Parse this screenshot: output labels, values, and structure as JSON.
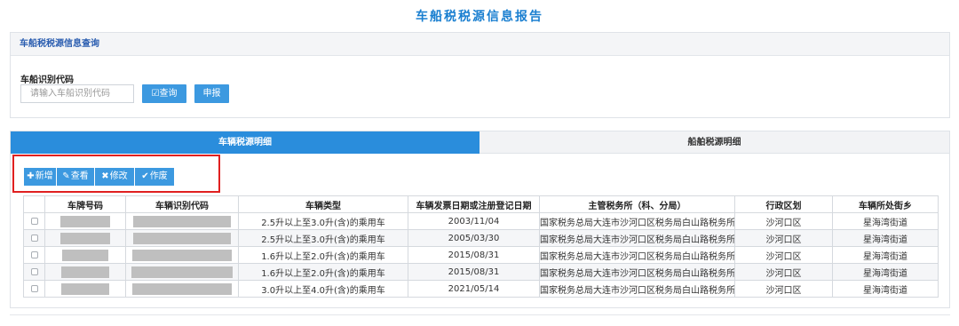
{
  "page": {
    "title": "车船税税源信息报告"
  },
  "query": {
    "section_title": "车船税税源信息查询",
    "field_label": "车船识别代码",
    "placeholder": "请输入车船识别代码",
    "query_button": "查询",
    "submit_button": "申报"
  },
  "tabs": [
    {
      "label": "车辆税源明细",
      "active": true
    },
    {
      "label": "船舶税源明细",
      "active": false
    }
  ],
  "toolbar": {
    "add": "新增",
    "view": "查看",
    "edit": "修改",
    "void": "作废"
  },
  "table": {
    "columns": [
      "车牌号码",
      "车辆识别代码",
      "车辆类型",
      "车辆发票日期或注册登记日期",
      "主管税务所（科、分局）",
      "行政区划",
      "车辆所处街乡"
    ],
    "rows": [
      {
        "type": "2.5升以上至3.0升(含)的乘用车",
        "date": "2003/11/04",
        "office": "国家税务总局大连市沙河口区税务局白山路税务所",
        "region": "沙河口区",
        "street": "星海湾街道"
      },
      {
        "type": "2.5升以上至3.0升(含)的乘用车",
        "date": "2005/03/30",
        "office": "国家税务总局大连市沙河口区税务局白山路税务所",
        "region": "沙河口区",
        "street": "星海湾街道"
      },
      {
        "type": "1.6升以上至2.0升(含)的乘用车",
        "date": "2015/08/31",
        "office": "国家税务总局大连市沙河口区税务局白山路税务所",
        "region": "沙河口区",
        "street": "星海湾街道"
      },
      {
        "type": "1.6升以上至2.0升(含)的乘用车",
        "date": "2015/08/31",
        "office": "国家税务总局大连市沙河口区税务局白山路税务所",
        "region": "沙河口区",
        "street": "星海湾街道"
      },
      {
        "type": "3.0升以上至4.0升(含)的乘用车",
        "date": "2021/05/14",
        "office": "国家税务总局大连市沙河口区税务局白山路税务所",
        "region": "沙河口区",
        "street": "星海湾街道"
      }
    ]
  },
  "colors": {
    "accent": "#2a8ddc",
    "button": "#3c99e0",
    "highlight_border": "#e02020",
    "title": "#1a7fd0"
  }
}
